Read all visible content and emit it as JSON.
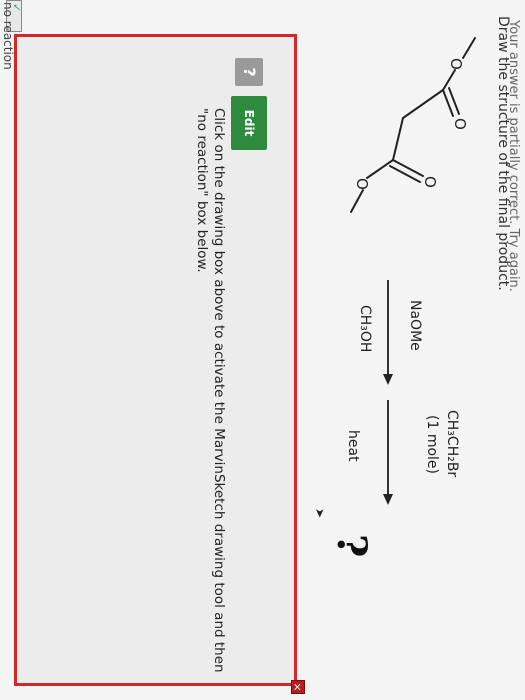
{
  "page": {
    "cut_off_text": "Your answer is partially correct. Try again.",
    "prompt": "Draw the structure of the final product."
  },
  "reaction": {
    "step1": {
      "above": "NaOMe",
      "below": "CH₃OH"
    },
    "step2": {
      "above_line1": "CH₃CH₂Br",
      "above_line2": "(1 mole)",
      "below": "heat"
    },
    "product": "?",
    "starting_material": {
      "carbonyl_O_1": "O",
      "carbonyl_O_2": "O",
      "ester_O_1": "O",
      "ester_O_2": "O"
    }
  },
  "answer_panel": {
    "close_label": "×",
    "help_label": "?",
    "edit_label": "Edit",
    "instruction": "Click on the drawing box above to activate the MarvinSketch drawing tool and then \"no reaction\" box below."
  },
  "no_reaction": {
    "label": "no reaction",
    "check": "✓"
  },
  "colors": {
    "panel_border": "#d22a2a",
    "edit_button": "#2e8b3d"
  },
  "icons": [
    "close-icon",
    "help-icon",
    "checkbox-icon",
    "cursor-icon"
  ]
}
